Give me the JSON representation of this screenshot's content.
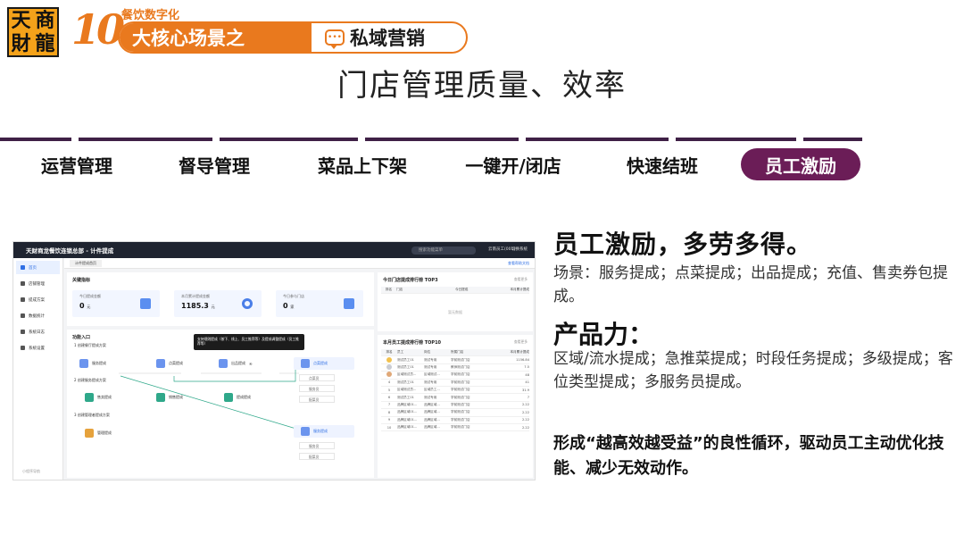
{
  "logo": {
    "chars": [
      "天",
      "商",
      "財",
      "龍"
    ]
  },
  "banner": {
    "number": "10",
    "subtitle": "餐饮数字化",
    "main": "大核心场景之",
    "topic": "私域营销"
  },
  "page_title": "门店管理质量、效率",
  "tabs": [
    {
      "label": "运营管理",
      "active": false
    },
    {
      "label": "督导管理",
      "active": false
    },
    {
      "label": "菜品上下架",
      "active": false
    },
    {
      "label": "一键开/闭店",
      "active": false
    },
    {
      "label": "快速结班",
      "active": false
    },
    {
      "label": "员工激励",
      "active": true
    }
  ],
  "mock": {
    "app_title": "天财商龙餐饮连锁总部 - 计件提成",
    "search_placeholder": "搜索功能菜单",
    "user": "云南员工(001)",
    "switch": "切换系统",
    "sidebar": [
      "首页",
      "店铺管理",
      "提成方案",
      "数据统计",
      "系统日志",
      "系统设置"
    ],
    "sidebar_footer": "小程序导航",
    "tab_label": "计件提成首页",
    "tab_right": "查看帮助文档",
    "kpi_title": "关键指标",
    "kpis": [
      {
        "label": "今日提成金额",
        "value": "0",
        "unit": "元"
      },
      {
        "label": "本月累计提成金额",
        "value": "1185.3",
        "unit": "元"
      },
      {
        "label": "今日参与门店",
        "value": "0",
        "unit": "家"
      }
    ],
    "func_title": "功能入口",
    "sec1": "1 创建餐厅提成方案",
    "sec2": "2 创建服务提成方案",
    "sec3": "3 创建管理者提成方案",
    "tooltip": "支持规则提成（按下、线上、员工推荐等）及提成调整提成（员工推荐等）",
    "nodes": [
      "服务提成",
      "点菜提成",
      "出品提成",
      "点菜提成",
      "售卖提成",
      "销售提成",
      "提成提成",
      "管理提成",
      "服务提成"
    ],
    "node_note": "④",
    "subs": [
      "点菜员",
      "服务员",
      "配菜员",
      "服务员",
      "配菜员"
    ],
    "top3_title": "今日门店提成排行榜 TOP3",
    "top3_more": "查看更多",
    "top3_headers": [
      "排名",
      "门店",
      "今日提成",
      "本月累计提成"
    ],
    "top3_empty": "暂无数据",
    "top10_title": "本月员工提成排行榜 TOP10",
    "top10_more": "查看更多",
    "top10_headers": [
      "排名",
      "员工",
      "岗位",
      "所属门店",
      "本月累计提成"
    ],
    "top10_rows": [
      [
        "1",
        "测试员工01",
        "测试专用",
        "学前测试门店",
        "1156.84"
      ],
      [
        "2",
        "测试员工01",
        "测试专用",
        "教师测试门店",
        "7.5"
      ],
      [
        "3",
        "区域测试员...",
        "区域测试...",
        "学前测试门店",
        "48"
      ],
      [
        "4",
        "测试员工01",
        "测试专用",
        "学前测试门店",
        "41"
      ],
      [
        "5",
        "区域测试员...",
        "区域员工...",
        "学前测试门店",
        "31.9"
      ],
      [
        "6",
        "测试员工01",
        "测试专用",
        "学前测试门店",
        "7"
      ],
      [
        "7",
        "品牌区域01...",
        "品牌区域...",
        "学前测试门店",
        "2.22"
      ],
      [
        "8",
        "品牌区域01...",
        "品牌区域...",
        "学前测试门店",
        "2.22"
      ],
      [
        "9",
        "品牌区域01...",
        "品牌区域...",
        "学前测试门店",
        "2.22"
      ],
      [
        "10",
        "品牌区域01...",
        "品牌区域...",
        "学前测试门店",
        "2.22"
      ]
    ]
  },
  "right": {
    "heading1": "员工激励，多劳多得。",
    "scene": "场景：服务提成；点菜提成；出品提成；充值、售卖券包提成。",
    "heading2": "产品力：",
    "product": "区域/流水提成；急推菜提成；时段任务提成；多级提成；客位类型提成；多服务员提成。",
    "conclusion": "形成“越高效越受益”的良性循环，驱动员工主动优化技能、减少无效动作。"
  },
  "colors": {
    "accent_orange": "#e9791e",
    "tab_active": "#6b1d57",
    "tab_line": "#3f2046"
  }
}
